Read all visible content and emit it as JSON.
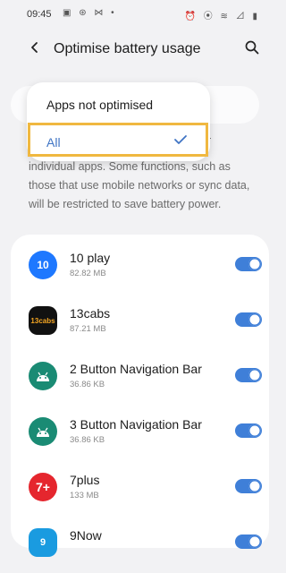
{
  "status_bar": {
    "time": "09:45",
    "left_icons": "▣ ⊛ ⋈ •",
    "right_icons": "⏰ ⦿ ≋ ⊿ ▮"
  },
  "header": {
    "title": "Optimise battery usage",
    "back_icon": "arrow-left-icon",
    "search_icon": "search-icon"
  },
  "filter_dropdown": {
    "options": [
      {
        "label": "Apps not optimised",
        "selected": false
      },
      {
        "label": "All",
        "selected": true
      }
    ]
  },
  "description": {
    "suffix": "r",
    "text": "individual apps. Some functions, such as those that use mobile networks or sync data, will be restricted to save battery power."
  },
  "apps": [
    {
      "name": "10 play",
      "size": "82.82 MB",
      "icon_text": "10",
      "icon_color": "#1e78ff",
      "toggle_on": true
    },
    {
      "name": "13cabs",
      "size": "87.21 MB",
      "icon_text": "13cabs",
      "icon_color": "#111111",
      "toggle_on": true
    },
    {
      "name": "2 Button Navigation Bar",
      "size": "36.86 KB",
      "icon_text": "android",
      "icon_color": "#1a8b74",
      "toggle_on": true
    },
    {
      "name": "3 Button Navigation Bar",
      "size": "36.86 KB",
      "icon_text": "android",
      "icon_color": "#1a8b74",
      "toggle_on": true
    },
    {
      "name": "7plus",
      "size": "133 MB",
      "icon_text": "7+",
      "icon_color": "#e5262e",
      "toggle_on": true
    },
    {
      "name": "9Now",
      "size": "",
      "icon_text": "9",
      "icon_color": "#1a9be0",
      "toggle_on": true
    }
  ],
  "colors": {
    "accent": "#3f7fd8",
    "highlight_border": "#f0b840",
    "background": "#f2f2f4"
  }
}
